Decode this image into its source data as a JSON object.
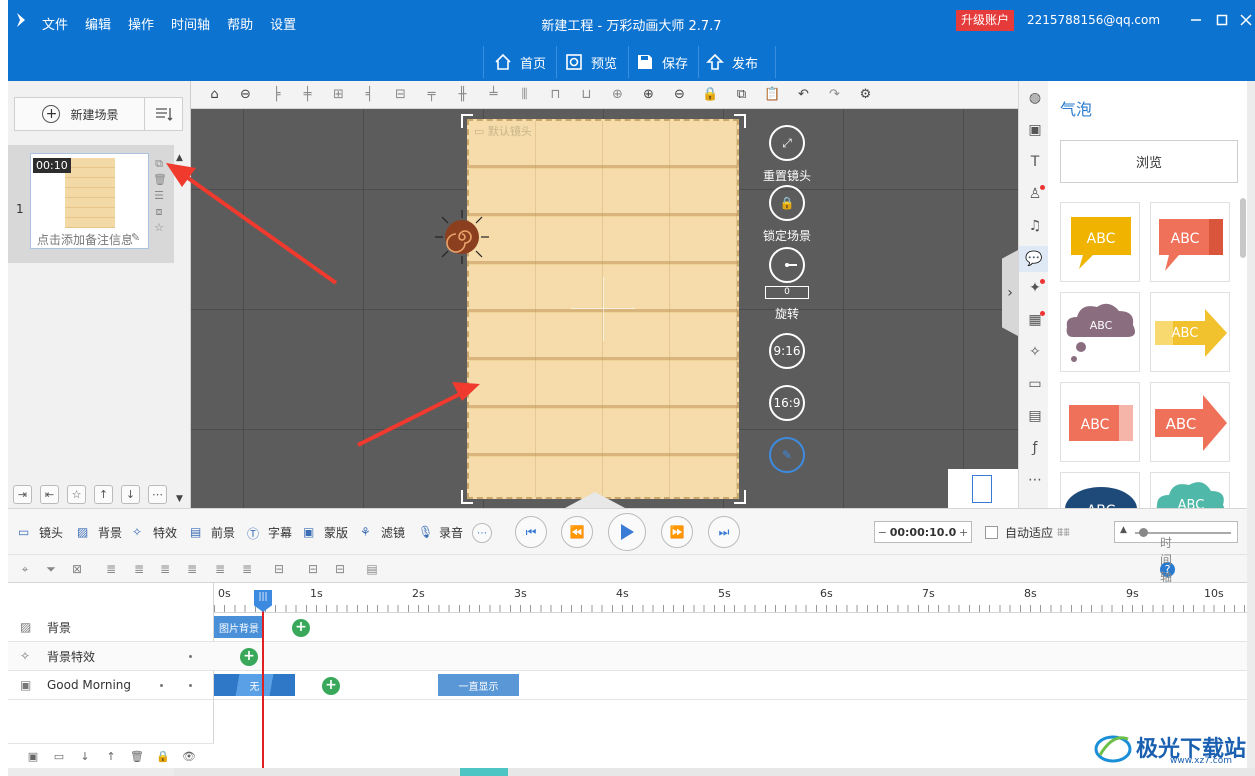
{
  "titlebar": {
    "menu": [
      "文件",
      "编辑",
      "操作",
      "时间轴",
      "帮助",
      "设置"
    ],
    "app_title": "新建工程 - 万彩动画大师 2.7.7",
    "upgrade": "升级账户",
    "user": "2215788156@qq.com"
  },
  "toolbar": {
    "home": "首页",
    "preview": "预览",
    "save": "保存",
    "publish": "发布"
  },
  "scenes": {
    "new_scene": "新建场景",
    "items": [
      {
        "number": "1",
        "duration": "00:10",
        "note": "点击添加备注信息"
      }
    ]
  },
  "stage": {
    "camera_label": "默认镜头",
    "controls": {
      "reset_camera": "重置镜头",
      "lock_scene": "锁定场景",
      "rotation_value": "0",
      "rotate": "旋转",
      "ratio_916": "9:16",
      "ratio_169": "16:9"
    }
  },
  "right_panel": {
    "title": "气泡",
    "browse": "浏览",
    "bubble_text": "ABC",
    "bubble_colors": [
      "#f0b400",
      "#f0715a",
      "#8a6e80",
      "#f2c12e",
      "#f0715a",
      "#f0715a",
      "#1e4a7a",
      "#4fb8a8"
    ]
  },
  "timeline": {
    "tabs": [
      "镜头",
      "背景",
      "特效",
      "前景",
      "字幕",
      "蒙版",
      "滤镜",
      "录音"
    ],
    "time_value": "00:00:10.0",
    "auto_fit": "自动适应",
    "help": "时间轴帮助",
    "ticks": [
      "0s",
      "1s",
      "2s",
      "3s",
      "4s",
      "5s",
      "6s",
      "7s",
      "8s",
      "9s",
      "10s"
    ],
    "tracks": [
      {
        "name": "背景",
        "clips": [
          {
            "label": "图片背景"
          }
        ]
      },
      {
        "name": "背景特效",
        "clips": []
      },
      {
        "name": "Good Morning",
        "clips": [
          {
            "label": "无"
          },
          {
            "label": "一直显示"
          }
        ]
      }
    ]
  },
  "watermark": {
    "text": "极光下载站",
    "sub": "www.xz7.com"
  },
  "colors": {
    "brand_blue": "#0d73d0",
    "upgrade_red": "#e63b3b",
    "keyframe_green": "#39a85a",
    "arrow_red": "#f03a2e"
  }
}
